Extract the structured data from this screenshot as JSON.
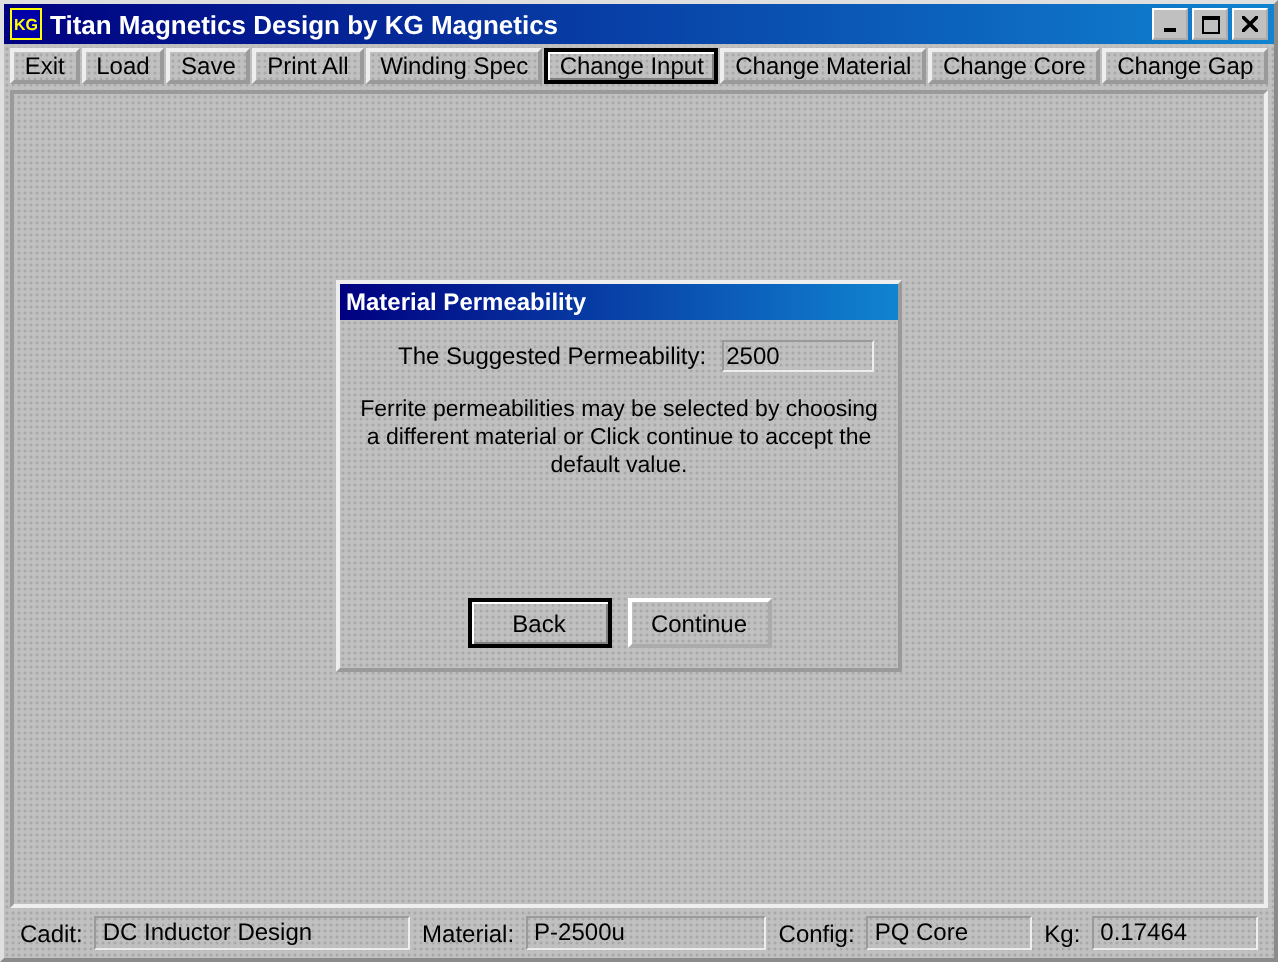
{
  "window": {
    "title": "Titan Magnetics Design by KG Magnetics",
    "logo": "KG"
  },
  "toolbar": [
    {
      "label": "Exit",
      "selected": false
    },
    {
      "label": "Load",
      "selected": false
    },
    {
      "label": "Save",
      "selected": false
    },
    {
      "label": "Print All",
      "selected": false
    },
    {
      "label": "Winding Spec",
      "selected": false
    },
    {
      "label": "Change Input",
      "selected": true
    },
    {
      "label": "Change Material",
      "selected": false
    },
    {
      "label": "Change Core",
      "selected": false
    },
    {
      "label": "Change Gap",
      "selected": false
    }
  ],
  "dialog": {
    "title": "Material Permeability",
    "field_label": "The Suggested Permeability:",
    "field_value": "2500",
    "message": "Ferrite permeabilities may be selected by choosing a different material or Click continue to accept the default value.",
    "buttons": [
      {
        "label": "Back",
        "focused": true
      },
      {
        "label": "Continue",
        "focused": false
      }
    ]
  },
  "status_bar": [
    {
      "label": "Cadit:",
      "value": "DC Inductor Design"
    },
    {
      "label": "Material:",
      "value": "P-2500u"
    },
    {
      "label": "Config:",
      "value": "PQ Core"
    },
    {
      "label": "Kg:",
      "value": "0.17464"
    }
  ]
}
